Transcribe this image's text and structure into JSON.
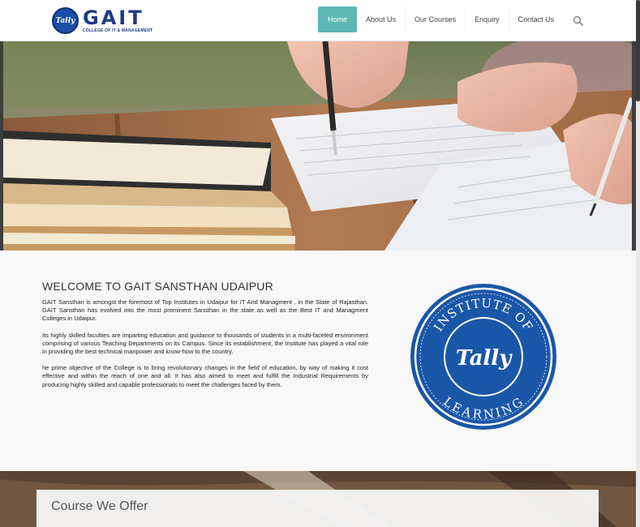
{
  "brand": {
    "logo_badge_text": "Tally",
    "name": "GAIT",
    "tagline": "COLLEGE OF IT & MANAGEMENT"
  },
  "nav": {
    "items": [
      {
        "label": "Home",
        "active": true
      },
      {
        "label": "About Us",
        "active": false
      },
      {
        "label": "Our Courses",
        "active": false
      },
      {
        "label": "Enquiry",
        "active": false
      },
      {
        "label": "Contact Us",
        "active": false
      }
    ],
    "search_icon": "search-icon"
  },
  "about": {
    "title": "WELCOME TO GAIT SANSTHAN UDAIPUR",
    "paragraphs": [
      "GAIT Sansthan is amongst the foremost of Top Institutes in Udaipur for IT And Managment , in the State of Rajasthan. GAIT Sansthan has evolved into the most prominent Sansthan in the state as well as the Best IT and Managment Colleges in Udaipur.",
      "Its highly skilled faculties are imparting education and guidance to thousands of students in a multi-faceted environment comprising of various Teaching Departments on its Campus. Since its establishment, the Institute has played a vital role in providing the best technical manpower and know-how to the country.",
      "he prime objective of the College is to bring revolutionary changes in the field of education, by way of making it cost effective and within the reach of one and all. It has also aimed to meet and fulfill the Industrial Requirements by producing highly skilled and capable professionals to meet the challenges faced by them."
    ],
    "seal": {
      "top_text": "INSTITUTE OF",
      "center_text": "Tally",
      "bottom_text": "LEARNING"
    }
  },
  "courses": {
    "title": "Course We Offer"
  },
  "colors": {
    "accent": "#5cb8b2",
    "brand_blue": "#1f3a84",
    "seal_blue": "#1b57a8"
  }
}
